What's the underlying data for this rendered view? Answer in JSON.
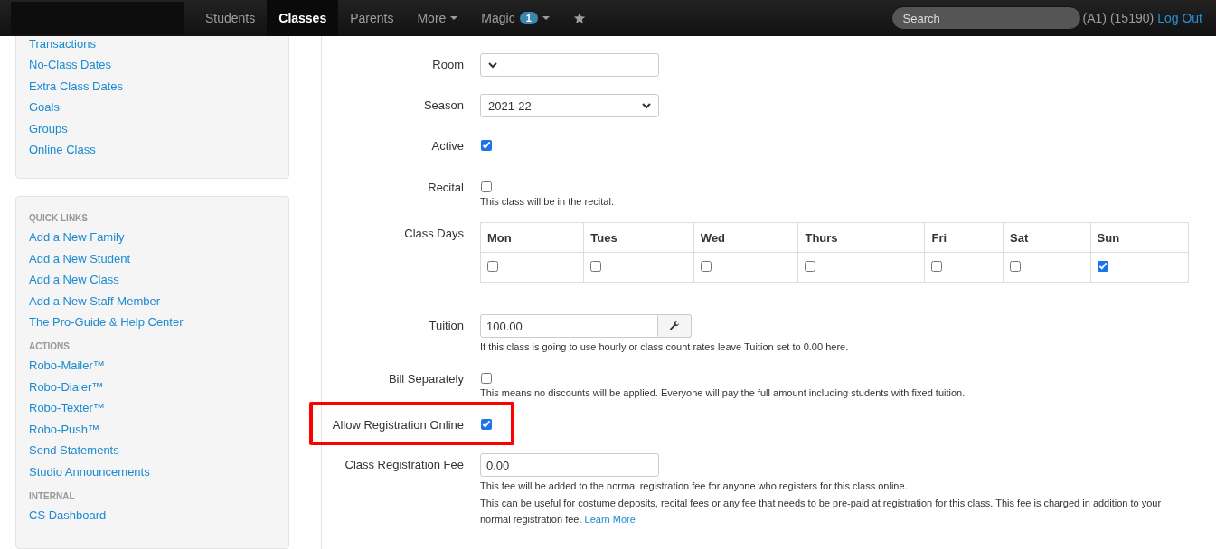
{
  "navbar": {
    "items": [
      {
        "kind": "link",
        "label": "Students",
        "selected": false
      },
      {
        "kind": "link",
        "label": "Classes",
        "selected": true
      },
      {
        "kind": "link",
        "label": "Parents",
        "selected": false
      },
      {
        "kind": "menu",
        "label": "More",
        "selected": false
      },
      {
        "kind": "menu",
        "label": "Magic",
        "badge": "1",
        "selected": false
      },
      {
        "kind": "star",
        "selected": false
      }
    ],
    "search": {
      "placeholder": "Search"
    },
    "account": "(A1) (15190)",
    "logout": "Log Out"
  },
  "sidebar": {
    "panels": [
      {
        "sections": [
          {
            "links": [
              "Transactions",
              "No-Class Dates",
              "Extra Class Dates",
              "Goals",
              "Groups",
              "Online Class"
            ]
          }
        ]
      },
      {
        "sections": [
          {
            "heading": "QUICK LINKS",
            "links": [
              "Add a New Family",
              "Add a New Student",
              "Add a New Class",
              "Add a New Staff Member",
              "The Pro-Guide & Help Center"
            ]
          },
          {
            "heading": "ACTIONS",
            "links": [
              "Robo-Mailer™",
              "Robo-Dialer™",
              "Robo-Texter™",
              "Robo-Push™",
              "Send Statements",
              "Studio Announcements"
            ]
          },
          {
            "heading": "INTERNAL",
            "links": [
              "CS Dashboard"
            ]
          }
        ]
      }
    ]
  },
  "form": {
    "rows": [
      {
        "kind": "select",
        "label": "Room"
      },
      {
        "kind": "select",
        "label": "Season",
        "value": "2021-22"
      },
      {
        "kind": "checkbox",
        "label": "Active",
        "checked": true
      },
      {
        "kind": "checkbox",
        "label": "Recital",
        "checked": false,
        "help": [
          {
            "text": "This class will be in the recital."
          }
        ]
      },
      {
        "kind": "days",
        "label": "Class Days",
        "days": [
          {
            "name": "Mon",
            "checked": false
          },
          {
            "name": "Tues",
            "checked": false
          },
          {
            "name": "Wed",
            "checked": false
          },
          {
            "name": "Thurs",
            "checked": false
          },
          {
            "name": "Fri",
            "checked": false
          },
          {
            "name": "Sat",
            "checked": false
          },
          {
            "name": "Sun",
            "checked": true
          }
        ]
      },
      {
        "kind": "tuition",
        "label": "Tuition",
        "value": "100.00",
        "help": [
          {
            "text": "If this class is going to use hourly or class count rates leave Tuition set to 0.00 here."
          }
        ]
      },
      {
        "kind": "checkbox",
        "label": "Bill Separately",
        "checked": false,
        "help": [
          {
            "text": "This means no discounts will be applied. Everyone will pay the full amount including students with fixed tuition."
          }
        ]
      },
      {
        "kind": "checkbox",
        "label": "Allow Registration Online",
        "checked": true,
        "highlighted": true
      },
      {
        "kind": "text",
        "label": "Class Registration Fee",
        "value": "0.00",
        "help": [
          {
            "text": "This fee will be added to the normal registration fee for anyone who registers for this class online."
          },
          {
            "text": "This can be useful for costume deposits, recital fees or any fee that needs to be pre-paid at registration for this class. This fee is charged in addition to your normal registration fee.",
            "link": "Learn More"
          }
        ]
      }
    ]
  }
}
